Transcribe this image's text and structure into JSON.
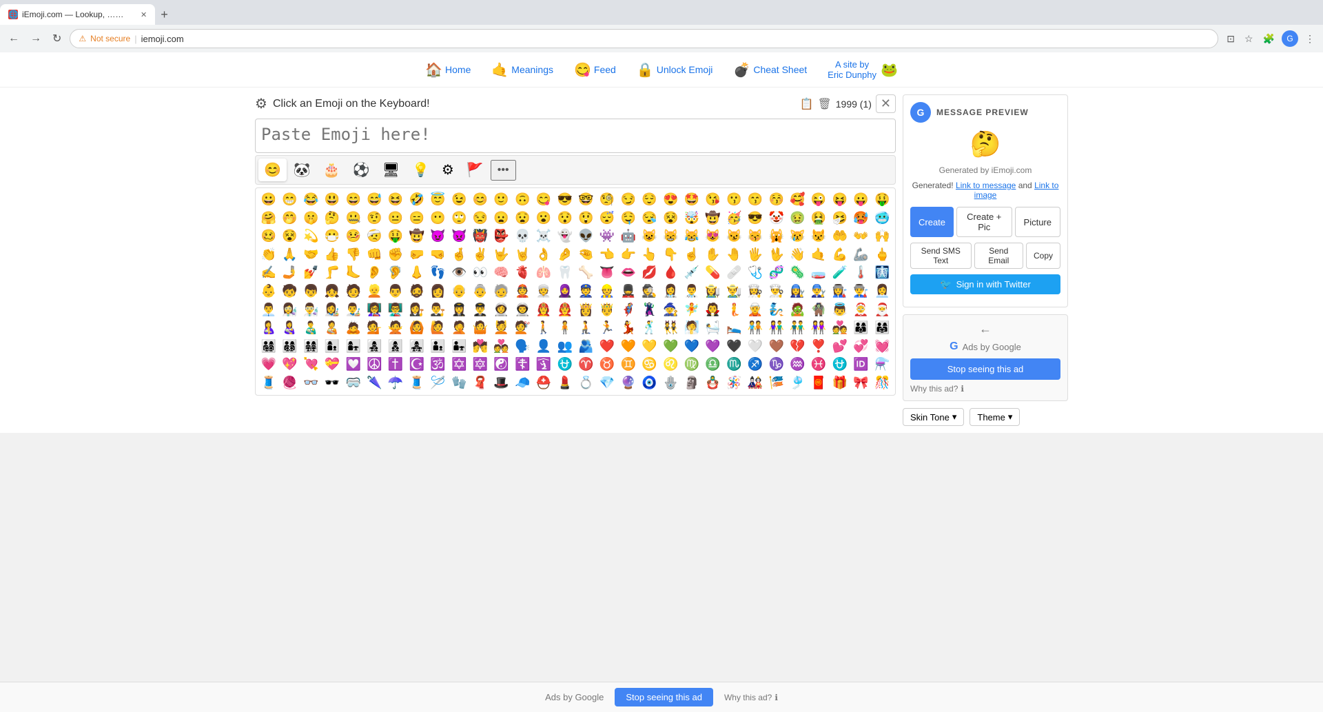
{
  "browser": {
    "tab_label": "iEmoji.com — Lookup, …✨ C",
    "tab_favicon_color": "#e53935",
    "url": "iemoji.com",
    "security_label": "Not secure"
  },
  "nav": {
    "items": [
      {
        "label": "Home",
        "icon": "🏠",
        "href": "#"
      },
      {
        "label": "Meanings",
        "icon": "🤙",
        "href": "#"
      },
      {
        "label": "Feed",
        "icon": "😋",
        "href": "#"
      },
      {
        "label": "Unlock Emoji",
        "icon": "🔒",
        "href": "#"
      },
      {
        "label": "Cheat Sheet",
        "icon": "💣",
        "href": "#"
      }
    ],
    "site_by_line1": "A site by",
    "site_by_line2": "Eric Dunphy",
    "site_by_icon": "🐸"
  },
  "emoji_panel": {
    "instruction": "Click an Emoji on the Keyboard!",
    "textarea_placeholder": "Paste Emoji here!",
    "counter_text": "1999 (1)",
    "categories": [
      {
        "icon": "😊",
        "label": "faces"
      },
      {
        "icon": "🐼",
        "label": "animals"
      },
      {
        "icon": "🎂",
        "label": "food"
      },
      {
        "icon": "⚽",
        "label": "sports"
      },
      {
        "icon": "🖥️",
        "label": "tech"
      },
      {
        "icon": "💡",
        "label": "objects"
      },
      {
        "icon": "⚙️",
        "label": "symbols"
      },
      {
        "icon": "🚩",
        "label": "flags"
      },
      {
        "icon": "•••",
        "label": "more"
      }
    ]
  },
  "preview": {
    "title": "MESSAGE PREVIEW",
    "emoji": "🤔",
    "generated_by": "Generated by iEmoji.com",
    "generated_text": "Generated!",
    "link_to_message": "Link to message",
    "and_text": "and",
    "link_to_image": "Link to image",
    "btn_create": "Create",
    "btn_create_pic": "Create + Pic",
    "btn_picture": "Picture",
    "btn_sms": "Send SMS Text",
    "btn_email": "Send Email",
    "btn_copy": "Copy",
    "btn_twitter": "Sign in with Twitter"
  },
  "ads": {
    "label": "Ads by Google",
    "stop_ad_label": "Stop seeing this ad",
    "why_ad_label": "Why this ad?",
    "back_arrow": "←"
  },
  "bottom_controls": {
    "skin_tone_label": "Skin Tone",
    "skin_tone_arrow": "▾",
    "theme_label": "Theme",
    "theme_arrow": "▾"
  },
  "bottom_ads": {
    "label": "Ads by Google",
    "stop_label": "Stop seeing this ad",
    "why_label": "Why this ad?"
  },
  "emojis": {
    "row1": [
      "😀",
      "😁",
      "😂",
      "😃",
      "😄",
      "😅",
      "😆",
      "🤣",
      "😇",
      "😉",
      "😊",
      "🙂",
      "🙃",
      "😋",
      "😎",
      "🤓",
      "🧐",
      "😏",
      "😌",
      "😍",
      "🤩",
      "😘",
      "😗",
      "😙",
      "😚",
      "🥰",
      "😜",
      "😝",
      "😛",
      "🤑"
    ],
    "row2": [
      "🤗",
      "🤭",
      "🤫",
      "🤔",
      "🤐",
      "🤨",
      "😐",
      "😑",
      "😶",
      "🙄",
      "😒",
      "😦",
      "😧",
      "😮",
      "😯",
      "😲",
      "😴",
      "🤤",
      "😪",
      "😵",
      "🤯",
      "🤠",
      "🥳",
      "😎",
      "🤡",
      "🤢",
      "🤮",
      "🤧",
      "🥵",
      "🥶"
    ],
    "row3": [
      "🥴",
      "😵",
      "💫",
      "😷",
      "🤒",
      "🤕",
      "🤑",
      "🤠",
      "😈",
      "👿",
      "👹",
      "👺",
      "💀",
      "☠️",
      "👻",
      "👽",
      "👾",
      "🤖",
      "😺",
      "😸",
      "😹",
      "😻",
      "😼",
      "😽",
      "🙀",
      "😿",
      "😾",
      "🤲",
      "👐",
      "🙌"
    ],
    "row4": [
      "👏",
      "🙏",
      "🤝",
      "👍",
      "👎",
      "👊",
      "✊",
      "🤛",
      "🤜",
      "🤞",
      "✌️",
      "🤟",
      "🤘",
      "👌",
      "🤌",
      "🤏",
      "👈",
      "👉",
      "👆",
      "👇",
      "☝️",
      "✋",
      "🤚",
      "🖐️",
      "🖖",
      "👋",
      "🤙",
      "💪",
      "🦾",
      "🖕"
    ],
    "row5": [
      "✍️",
      "🤳",
      "💅",
      "🦵",
      "🦶",
      "👂",
      "🦻",
      "👃",
      "👣",
      "👁️",
      "👀",
      "🧠",
      "🫀",
      "🫁",
      "🦷",
      "🦴",
      "👅",
      "👄",
      "💋",
      "🩸",
      "💉",
      "💊",
      "🩹",
      "🩺",
      "🧬",
      "🦠",
      "🧫",
      "🧪",
      "🌡️",
      "🩻"
    ],
    "row6": [
      "👶",
      "🧒",
      "👦",
      "👧",
      "🧑",
      "👱",
      "👨",
      "🧔",
      "👩",
      "👴",
      "👵",
      "🧓",
      "👲",
      "👳",
      "🧕",
      "👮",
      "👷",
      "💂",
      "🕵️",
      "👩‍⚕️",
      "👨‍⚕️",
      "👩‍🌾",
      "👨‍🌾",
      "👩‍🍳",
      "👨‍🍳",
      "👩‍🔧",
      "👨‍🔧",
      "👩‍🏭",
      "👨‍🏭",
      "👩‍💼"
    ],
    "row7": [
      "👨‍💼",
      "👩‍🔬",
      "👨‍🔬",
      "👩‍🎨",
      "👨‍🎨",
      "👩‍🏫",
      "👨‍🏫",
      "👩‍⚖️",
      "👨‍⚖️",
      "👩‍✈️",
      "👨‍✈️",
      "👩‍🚀",
      "👨‍🚀",
      "👩‍🚒",
      "👨‍🚒",
      "👸",
      "🤴",
      "🦸",
      "🦹",
      "🧙",
      "🧚",
      "🧛",
      "🧜",
      "🧝",
      "🧞",
      "🧟",
      "🧌",
      "👼",
      "🤶",
      "🎅"
    ],
    "row8": [
      "🤱",
      "👩‍🍼",
      "👨‍🍼",
      "🧑‍🍼",
      "🙇",
      "💁",
      "🙅",
      "🙆",
      "🙋",
      "🤦",
      "🤷",
      "💆",
      "💇",
      "🚶",
      "🧍",
      "🧎",
      "🏃",
      "💃",
      "🕺",
      "👯",
      "🧖",
      "🛀",
      "🛌",
      "🧑‍🤝‍🧑",
      "👫",
      "👬",
      "👭",
      "💑",
      "👨‍👩‍👦",
      "👨‍👩‍👧"
    ],
    "row9": [
      "👨‍👩‍👧‍👦",
      "👨‍👩‍👦‍👦",
      "👨‍👩‍👧‍👧",
      "👩‍👦",
      "👩‍👧",
      "👩‍👧‍👦",
      "👩‍👦‍👦",
      "👩‍👧‍👧",
      "👨‍👦",
      "👨‍👧",
      "💏",
      "💑",
      "🗣️",
      "👤",
      "👥",
      "🫂",
      "❤️",
      "🧡",
      "💛",
      "💚",
      "💙",
      "💜",
      "🖤",
      "🤍",
      "🤎",
      "💔",
      "❣️",
      "💕",
      "💞",
      "💓"
    ],
    "row10": [
      "💗",
      "💖",
      "💘",
      "💝",
      "💟",
      "☮️",
      "✝️",
      "☪️",
      "🕉️",
      "✡️",
      "🔯",
      "☯️",
      "☦️",
      "🛐",
      "⛎",
      "♈",
      "♉",
      "♊",
      "♋",
      "♌",
      "♍",
      "♎",
      "♏",
      "♐",
      "♑",
      "♒",
      "♓",
      "⛎",
      "🆔",
      "⚗️"
    ],
    "row11": [
      "🧵",
      "🧶",
      "👓",
      "🕶️",
      "🥽",
      "🌂",
      "☂️",
      "🧵",
      "🪡",
      "🧤",
      "🧣",
      "🎩",
      "🧢",
      "⛑️",
      "💄",
      "💍",
      "💎",
      "🔮",
      "🧿",
      "🪬",
      "🗿",
      "🪆",
      "🪅",
      "🎎",
      "🎏",
      "🎐",
      "🧧",
      "🎁",
      "🎀",
      "🎊"
    ]
  }
}
